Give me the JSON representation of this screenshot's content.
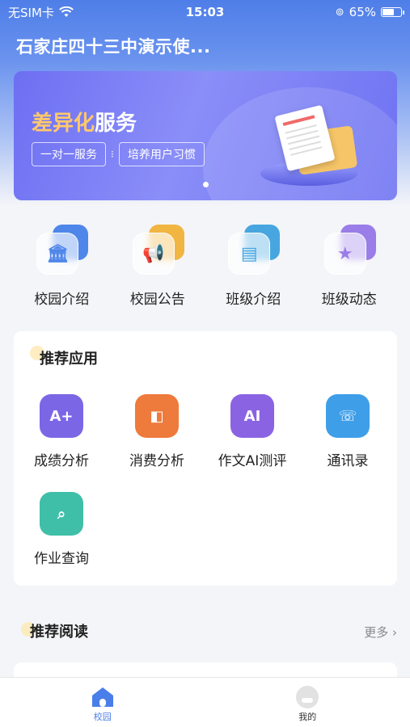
{
  "status_bar": {
    "carrier": "无SIM卡",
    "time": "15:03",
    "battery": "65%",
    "battery_level": 0.65
  },
  "header": {
    "title": "石家庄四十三中演示使..."
  },
  "banner": {
    "title_highlight": "差异化",
    "title_rest": "服务",
    "tags": [
      "一对一服务",
      "培养用户习惯"
    ]
  },
  "quick_entries": [
    {
      "label": "校园介绍",
      "icon": "building-icon",
      "color": "#4f86ea",
      "glyph": "🏛"
    },
    {
      "label": "校园公告",
      "icon": "megaphone-icon",
      "color": "#f1b542",
      "glyph": "📢"
    },
    {
      "label": "班级介绍",
      "icon": "blackboard-icon",
      "color": "#47a6e0",
      "glyph": "▤"
    },
    {
      "label": "班级动态",
      "icon": "star-icon",
      "color": "#9a7de8",
      "glyph": "★"
    }
  ],
  "recommended_apps": {
    "title": "推荐应用",
    "items": [
      {
        "label": "成绩分析",
        "icon": "grade-report-icon",
        "color": "#7b66e6",
        "glyph": "A+"
      },
      {
        "label": "消费分析",
        "icon": "wallet-icon",
        "color": "#ee7a3c",
        "glyph": "◧"
      },
      {
        "label": "作文AI测评",
        "icon": "ai-scan-icon",
        "color": "#8a63e3",
        "glyph": "AI"
      },
      {
        "label": "通讯录",
        "icon": "phone-book-icon",
        "color": "#3f9ee8",
        "glyph": "☏"
      },
      {
        "label": "作业查询",
        "icon": "homework-search-icon",
        "color": "#3fbfa8",
        "glyph": "⌕"
      }
    ]
  },
  "reading": {
    "title": "推荐阅读",
    "more": "更多 ›"
  },
  "tab_bar": [
    {
      "label": "校园",
      "icon": "home-icon",
      "active": true,
      "color": "#4a7ee8"
    },
    {
      "label": "我的",
      "icon": "profile-icon",
      "active": false,
      "color": "#333333"
    }
  ]
}
